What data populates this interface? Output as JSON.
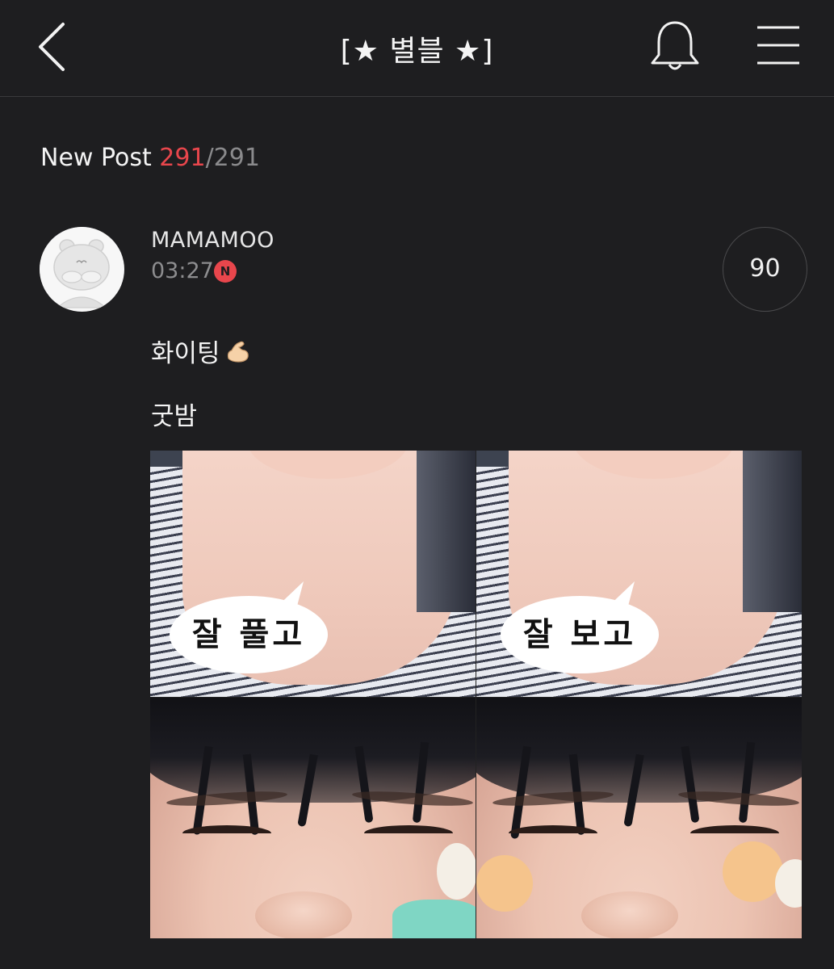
{
  "header": {
    "title": "[★ 별블 ★]"
  },
  "new_post": {
    "label": "New Post",
    "current": "291",
    "separator": "/",
    "total": "291"
  },
  "post": {
    "author": "MAMAMOO",
    "time": "03:27",
    "badge": "N",
    "comment_count": "90",
    "line1": "화이팅",
    "line2": "굿밤",
    "image": {
      "bubble_left": "잘 풀고",
      "bubble_right": "잘 보고"
    }
  },
  "colors": {
    "background": "#1e1e20",
    "accent": "#e8464c",
    "muted": "#8a8a8c"
  },
  "icons": {
    "back": "chevron-left-icon",
    "bell": "bell-icon",
    "menu": "hamburger-menu-icon",
    "muscle": "flexed-biceps-icon"
  }
}
